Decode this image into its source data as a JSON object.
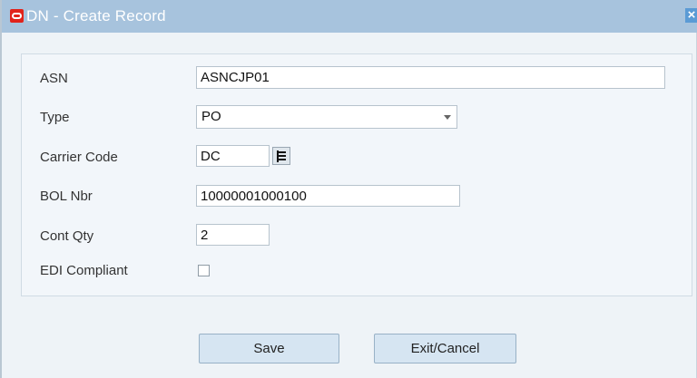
{
  "window": {
    "title": "DN - Create Record",
    "close_glyph": "×",
    "logo_icon": "oracle-logo-icon"
  },
  "form": {
    "asn": {
      "label": "ASN",
      "value": "ASNCJP01"
    },
    "type": {
      "label": "Type",
      "value": "PO"
    },
    "carrier_code": {
      "label": "Carrier Code",
      "value": "DC",
      "lov_icon": "list-of-values-icon"
    },
    "bol_nbr": {
      "label": "BOL Nbr",
      "value": "10000001000100"
    },
    "cont_qty": {
      "label": "Cont Qty",
      "value": "2"
    },
    "edi_compliant": {
      "label": "EDI Compliant",
      "checked": false
    }
  },
  "buttons": {
    "save": "Save",
    "exit_cancel": "Exit/Cancel"
  },
  "colors": {
    "titlebar": "#a7c3dd",
    "dialog_bg": "#eef3f7",
    "button_bg": "#d6e5f2",
    "logo_red": "#e1231b"
  }
}
